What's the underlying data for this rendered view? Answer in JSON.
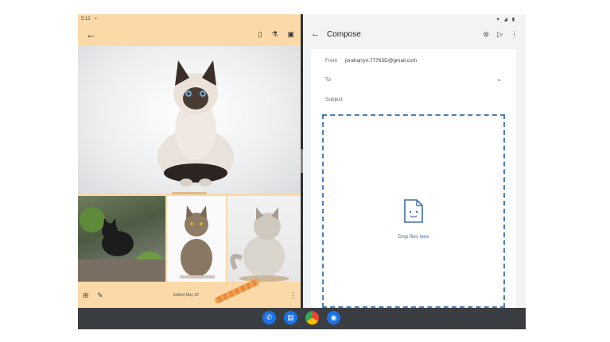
{
  "status_left": {
    "time": "5:12",
    "icon": "sim-icon"
  },
  "status_right": {
    "icons": "▾ ◢ ▮"
  },
  "gallery": {
    "back_glyph": "←",
    "actions": [
      "▯",
      "⚗",
      "▣"
    ],
    "date": "Edited May 20"
  },
  "compose": {
    "back_glyph": "←",
    "title": "Compose",
    "actions": [
      "⊚",
      "▷",
      "⋮"
    ],
    "from_label": "From",
    "from_value": "joraharryn.77763D@gmail.com",
    "to_label": "To",
    "chevron": "⌄",
    "subject_label": "Subject",
    "drop_label": "Drop files here"
  },
  "dock": {
    "apps": [
      {
        "name": "phone",
        "glyph": "✆"
      },
      {
        "name": "messages",
        "glyph": "▤"
      },
      {
        "name": "chrome",
        "glyph": ""
      },
      {
        "name": "camera",
        "glyph": "◉"
      }
    ]
  },
  "colors": {
    "gallery_accent": "#fbd9a8",
    "compose_bg": "#f1f3f4",
    "drop_border": "#4a7fb8",
    "taskbar": "#3a3d42"
  }
}
